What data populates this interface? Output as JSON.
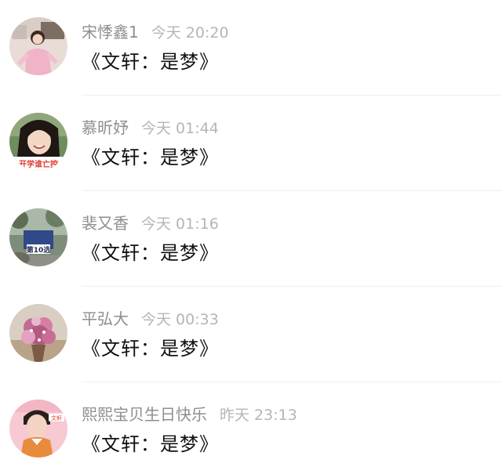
{
  "comments": [
    {
      "name": "宋悸鑫1",
      "time": "今天 20:20",
      "text": "《文轩：是梦》",
      "avatar": "girl-pink-outfit"
    },
    {
      "name": "慕昕妤",
      "time": "今天 01:44",
      "text": "《文轩：是梦》",
      "avatar": "girl-smiling",
      "avatar_caption": "开学谁亡控"
    },
    {
      "name": "裴又香",
      "time": "今天 01:16",
      "text": "《文轩：是梦》",
      "avatar": "outdoor-scene",
      "avatar_caption": "第10选"
    },
    {
      "name": "平弘大",
      "time": "今天 00:33",
      "text": "《文轩：是梦》",
      "avatar": "flower-bouquet"
    },
    {
      "name": "熙熙宝贝生日快乐",
      "time": "昨天 23:13",
      "text": "《文轩：是梦》",
      "avatar": "boy-pink-background",
      "avatar_caption": "文轩"
    }
  ]
}
